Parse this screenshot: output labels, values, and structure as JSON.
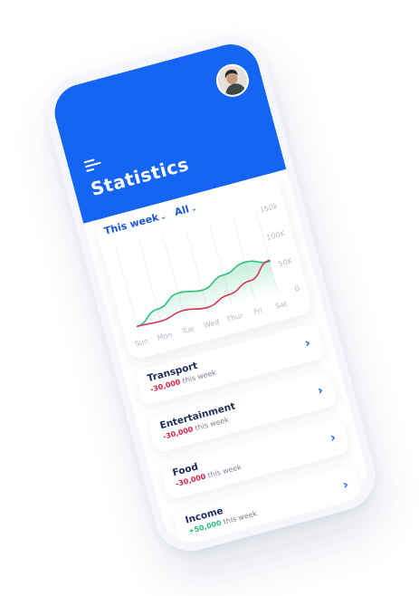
{
  "header": {
    "title": "Statistics"
  },
  "chart": {
    "filters": [
      {
        "label": "This week",
        "icon": "chevron-down-icon"
      },
      {
        "label": "All",
        "icon": "chevron-down-icon"
      }
    ],
    "accent_color": "#1565f4"
  },
  "chart_data": {
    "type": "line",
    "categories": [
      "Sun",
      "Mon",
      "Tue",
      "Wed",
      "Thur",
      "Fri",
      "Sat"
    ],
    "y_tick_labels": [
      "150k",
      "100K",
      "50K",
      "0"
    ],
    "ylim": [
      0,
      150
    ],
    "grid": true,
    "series": [
      {
        "color": "#2ec27e",
        "values": [
          8,
          28,
          46,
          40,
          56,
          68,
          58
        ],
        "fill": true
      },
      {
        "color": "#d33b57",
        "values": [
          8,
          6,
          14,
          8,
          20,
          34,
          60
        ],
        "fill": false
      }
    ]
  },
  "categories": [
    {
      "name": "Transport",
      "amount": "-30,000",
      "suffix": "this week",
      "trend": "negative"
    },
    {
      "name": "Entertainment",
      "amount": "-30,000",
      "suffix": "this week",
      "trend": "negative"
    },
    {
      "name": "Food",
      "amount": "-30,000",
      "suffix": "this week",
      "trend": "negative"
    },
    {
      "name": "Income",
      "amount": "+50,000",
      "suffix": "this week",
      "trend": "positive"
    }
  ]
}
